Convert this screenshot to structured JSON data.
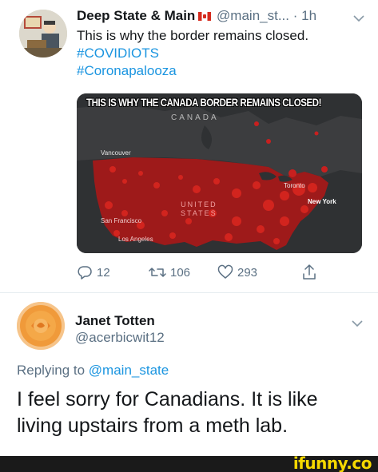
{
  "tweet1": {
    "author": {
      "display_name": "Deep State & Main",
      "flag_icon": "canada-flag-icon",
      "handle": "@main_st...",
      "separator": "·",
      "time": "1h"
    },
    "text_lines": [
      "This is why the border remains closed."
    ],
    "hashtags": [
      "#COVIDIOTS",
      "#Coronapalooza"
    ],
    "image": {
      "headline": "THIS IS WHY THE CANADA BORDER REMAINS CLOSED!",
      "labels": {
        "canada": "CANADA",
        "vancouver": "Vancouver",
        "toronto": "Toronto",
        "new_york": "New York",
        "united": "UNITED",
        "states": "STATES",
        "san_francisco": "San Francisco",
        "los_angeles": "Los Angeles"
      },
      "colors": {
        "land": "#3a3b3d",
        "water": "#2f3133",
        "cases": "#c8201f"
      }
    },
    "actions": {
      "replies": "12",
      "retweets": "106",
      "likes": "293"
    }
  },
  "tweet2": {
    "author": {
      "display_name": "Janet Totten",
      "handle": "@acerbicwit12"
    },
    "replying_prefix": "Replying to",
    "replying_to": "@main_state",
    "body_lines": [
      "I feel sorry for Canadians. It is like",
      "living upstairs from a meth lab."
    ]
  },
  "watermark": {
    "text": "ifunny.co"
  },
  "colors": {
    "link": "#1b95e0",
    "muted": "#5b7083",
    "text": "#14171a"
  }
}
